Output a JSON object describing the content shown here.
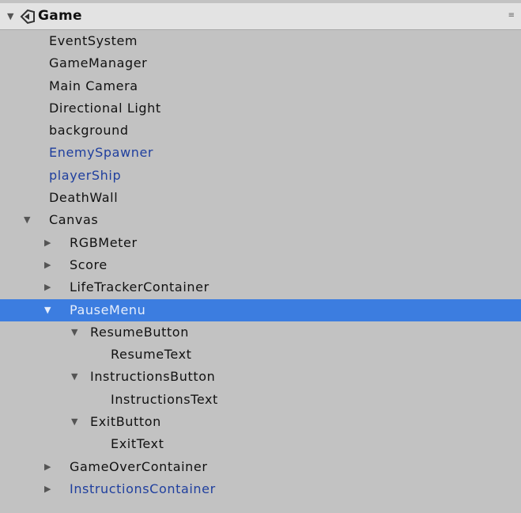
{
  "scene": {
    "name": "Game",
    "menu_icon": "≡"
  },
  "rows": [
    {
      "label": "EventSystem",
      "depth": 0,
      "arrow": "",
      "prefab": false,
      "selected": false
    },
    {
      "label": "GameManager",
      "depth": 0,
      "arrow": "",
      "prefab": false,
      "selected": false
    },
    {
      "label": "Main Camera",
      "depth": 0,
      "arrow": "",
      "prefab": false,
      "selected": false
    },
    {
      "label": "Directional Light",
      "depth": 0,
      "arrow": "",
      "prefab": false,
      "selected": false
    },
    {
      "label": "background",
      "depth": 0,
      "arrow": "",
      "prefab": false,
      "selected": false
    },
    {
      "label": "EnemySpawner",
      "depth": 0,
      "arrow": "",
      "prefab": true,
      "selected": false
    },
    {
      "label": "playerShip",
      "depth": 0,
      "arrow": "",
      "prefab": true,
      "selected": false
    },
    {
      "label": "DeathWall",
      "depth": 0,
      "arrow": "",
      "prefab": false,
      "selected": false
    },
    {
      "label": "Canvas",
      "depth": 0,
      "arrow": "expanded",
      "prefab": false,
      "selected": false
    },
    {
      "label": "RGBMeter",
      "depth": 1,
      "arrow": "collapsed",
      "prefab": false,
      "selected": false
    },
    {
      "label": "Score",
      "depth": 1,
      "arrow": "collapsed",
      "prefab": false,
      "selected": false
    },
    {
      "label": "LifeTrackerContainer",
      "depth": 1,
      "arrow": "collapsed",
      "prefab": false,
      "selected": false
    },
    {
      "label": "PauseMenu",
      "depth": 1,
      "arrow": "expanded",
      "prefab": false,
      "selected": true
    },
    {
      "label": "ResumeButton",
      "depth": 2,
      "arrow": "expanded",
      "prefab": false,
      "selected": false
    },
    {
      "label": "ResumeText",
      "depth": 3,
      "arrow": "",
      "prefab": false,
      "selected": false
    },
    {
      "label": "InstructionsButton",
      "depth": 2,
      "arrow": "expanded",
      "prefab": false,
      "selected": false
    },
    {
      "label": "InstructionsText",
      "depth": 3,
      "arrow": "",
      "prefab": false,
      "selected": false
    },
    {
      "label": "ExitButton",
      "depth": 2,
      "arrow": "expanded",
      "prefab": false,
      "selected": false
    },
    {
      "label": "ExitText",
      "depth": 3,
      "arrow": "",
      "prefab": false,
      "selected": false
    },
    {
      "label": "GameOverContainer",
      "depth": 1,
      "arrow": "collapsed",
      "prefab": false,
      "selected": false
    },
    {
      "label": "InstructionsContainer",
      "depth": 1,
      "arrow": "collapsed",
      "prefab": true,
      "selected": false
    }
  ],
  "colors": {
    "background": "#c2c2c2",
    "header": "#e3e3e3",
    "selection": "#3c7de0",
    "prefab_text": "#1f3f9e"
  }
}
